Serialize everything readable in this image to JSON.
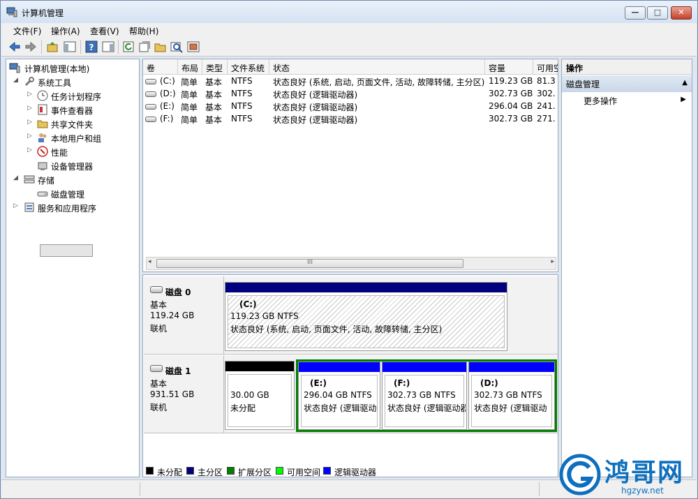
{
  "window": {
    "title": "计算机管理",
    "buttons": {
      "minimize": "—",
      "maximize": "□",
      "close": "✕"
    }
  },
  "menu": [
    "文件(F)",
    "操作(A)",
    "查看(V)",
    "帮助(H)"
  ],
  "tree": {
    "root": "计算机管理(本地)",
    "items": [
      {
        "label": "系统工具",
        "level": 1,
        "expanded": true
      },
      {
        "label": "任务计划程序",
        "level": 2
      },
      {
        "label": "事件查看器",
        "level": 2
      },
      {
        "label": "共享文件夹",
        "level": 2
      },
      {
        "label": "本地用户和组",
        "level": 2
      },
      {
        "label": "性能",
        "level": 2
      },
      {
        "label": "设备管理器",
        "level": 2
      },
      {
        "label": "存储",
        "level": 1,
        "expanded": true
      },
      {
        "label": "磁盘管理",
        "level": 2,
        "selected": true
      },
      {
        "label": "服务和应用程序",
        "level": 1
      }
    ]
  },
  "volume_table": {
    "columns": [
      "卷",
      "布局",
      "类型",
      "文件系统",
      "状态",
      "容量",
      "可用空"
    ],
    "rows": [
      {
        "vol": "(C:)",
        "layout": "简单",
        "type": "基本",
        "fs": "NTFS",
        "status": "状态良好 (系统, 启动, 页面文件, 活动, 故障转储, 主分区)",
        "capacity": "119.23 GB",
        "free": "81.3"
      },
      {
        "vol": "(D:)",
        "layout": "简单",
        "type": "基本",
        "fs": "NTFS",
        "status": "状态良好 (逻辑驱动器)",
        "capacity": "302.73 GB",
        "free": "302."
      },
      {
        "vol": "(E:)",
        "layout": "简单",
        "type": "基本",
        "fs": "NTFS",
        "status": "状态良好 (逻辑驱动器)",
        "capacity": "296.04 GB",
        "free": "241."
      },
      {
        "vol": "(F:)",
        "layout": "简单",
        "type": "基本",
        "fs": "NTFS",
        "status": "状态良好 (逻辑驱动器)",
        "capacity": "302.73 GB",
        "free": "271."
      }
    ],
    "scroll_grip": "III"
  },
  "disks": [
    {
      "name": "磁盘 0",
      "type": "基本",
      "size": "119.24 GB",
      "state": "联机",
      "partitions": [
        {
          "label": "(C:)",
          "size": "119.23 GB NTFS",
          "status": "状态良好 (系统, 启动, 页面文件, 活动, 故障转储, 主分区)",
          "bar_color": "#00007f"
        }
      ]
    },
    {
      "name": "磁盘 1",
      "type": "基本",
      "size": "931.51 GB",
      "state": "联机",
      "partitions": [
        {
          "label": "",
          "size": "30.00 GB",
          "status": "未分配",
          "bar_color": "#000000"
        },
        {
          "label": "(E:)",
          "size": "296.04 GB NTFS",
          "status": "状态良好 (逻辑驱动",
          "bar_color": "#0000ff"
        },
        {
          "label": "(F:)",
          "size": "302.73 GB NTFS",
          "status": "状态良好 (逻辑驱动器",
          "bar_color": "#0000ff"
        },
        {
          "label": "(D:)",
          "size": "302.73 GB NTFS",
          "status": "状态良好 (逻辑驱动",
          "bar_color": "#0000ff"
        }
      ],
      "extended_color": "#007f00"
    }
  ],
  "legend": [
    {
      "label": "未分配",
      "color": "#000000"
    },
    {
      "label": "主分区",
      "color": "#00007f"
    },
    {
      "label": "扩展分区",
      "color": "#007f00"
    },
    {
      "label": "可用空间",
      "color": "#00ff00"
    },
    {
      "label": "逻辑驱动器",
      "color": "#0000ff"
    }
  ],
  "actions": {
    "header": "操作",
    "section": "磁盘管理",
    "more": "更多操作"
  },
  "watermark": {
    "brand": "鸿哥网",
    "url": "hgzyw.net"
  }
}
